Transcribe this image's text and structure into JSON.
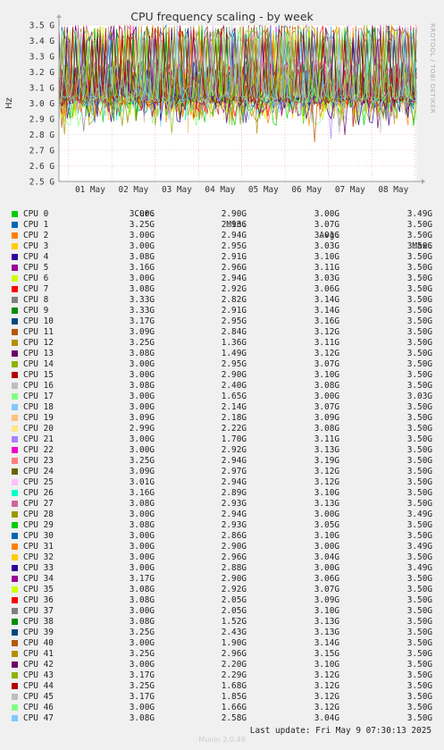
{
  "title": "CPU frequency scaling - by week",
  "side_label": "RRDTOOL / TOBI OETIKER",
  "ylabel": "Hz",
  "columns": [
    "Cur:",
    "Min:",
    "Avg:",
    "Max:"
  ],
  "last_update": "Last update: Fri May  9 07:30:13 2025",
  "footer": "Munin 2.0.49",
  "chart_data": {
    "type": "line",
    "title": "CPU frequency scaling - by week",
    "ylabel": "Hz",
    "ylim": [
      2.5,
      3.5
    ],
    "yticks": [
      "2.5 G",
      "2.6 G",
      "2.7 G",
      "2.8 G",
      "2.9 G",
      "3.0 G",
      "3.1 G",
      "3.2 G",
      "3.3 G",
      "3.4 G",
      "3.5 G"
    ],
    "categories": [
      "01 May",
      "02 May",
      "03 May",
      "04 May",
      "05 May",
      "06 May",
      "07 May",
      "08 May"
    ],
    "grid": true,
    "legend": "below",
    "series": [
      {
        "name": "CPU 0",
        "color": "#00cc00",
        "cur": "3.00G",
        "min": "2.90G",
        "avg": "3.00G",
        "max": "3.49G"
      },
      {
        "name": "CPU 1",
        "color": "#0066b3",
        "cur": "3.25G",
        "min": "2.93G",
        "avg": "3.07G",
        "max": "3.50G"
      },
      {
        "name": "CPU 2",
        "color": "#ff8000",
        "cur": "3.00G",
        "min": "2.94G",
        "avg": "3.01G",
        "max": "3.50G"
      },
      {
        "name": "CPU 3",
        "color": "#ffcc00",
        "cur": "3.00G",
        "min": "2.95G",
        "avg": "3.03G",
        "max": "3.50G"
      },
      {
        "name": "CPU 4",
        "color": "#330099",
        "cur": "3.08G",
        "min": "2.91G",
        "avg": "3.10G",
        "max": "3.50G"
      },
      {
        "name": "CPU 5",
        "color": "#990099",
        "cur": "3.16G",
        "min": "2.96G",
        "avg": "3.11G",
        "max": "3.50G"
      },
      {
        "name": "CPU 6",
        "color": "#ccff00",
        "cur": "3.00G",
        "min": "2.94G",
        "avg": "3.03G",
        "max": "3.50G"
      },
      {
        "name": "CPU 7",
        "color": "#ff0000",
        "cur": "3.08G",
        "min": "2.92G",
        "avg": "3.06G",
        "max": "3.50G"
      },
      {
        "name": "CPU 8",
        "color": "#808080",
        "cur": "3.33G",
        "min": "2.82G",
        "avg": "3.14G",
        "max": "3.50G"
      },
      {
        "name": "CPU 9",
        "color": "#008f00",
        "cur": "3.33G",
        "min": "2.91G",
        "avg": "3.14G",
        "max": "3.50G"
      },
      {
        "name": "CPU 10",
        "color": "#00487d",
        "cur": "3.17G",
        "min": "2.95G",
        "avg": "3.16G",
        "max": "3.50G"
      },
      {
        "name": "CPU 11",
        "color": "#b35a00",
        "cur": "3.09G",
        "min": "2.84G",
        "avg": "3.12G",
        "max": "3.50G"
      },
      {
        "name": "CPU 12",
        "color": "#b38f00",
        "cur": "3.25G",
        "min": "1.36G",
        "avg": "3.11G",
        "max": "3.50G"
      },
      {
        "name": "CPU 13",
        "color": "#6b006b",
        "cur": "3.08G",
        "min": "1.49G",
        "avg": "3.12G",
        "max": "3.50G"
      },
      {
        "name": "CPU 14",
        "color": "#8fb300",
        "cur": "3.00G",
        "min": "2.95G",
        "avg": "3.07G",
        "max": "3.50G"
      },
      {
        "name": "CPU 15",
        "color": "#b30000",
        "cur": "3.00G",
        "min": "2.90G",
        "avg": "3.10G",
        "max": "3.50G"
      },
      {
        "name": "CPU 16",
        "color": "#bebebe",
        "cur": "3.08G",
        "min": "2.40G",
        "avg": "3.08G",
        "max": "3.50G"
      },
      {
        "name": "CPU 17",
        "color": "#80ff80",
        "cur": "3.00G",
        "min": "1.65G",
        "avg": "3.00G",
        "max": "3.03G"
      },
      {
        "name": "CPU 18",
        "color": "#80c9ff",
        "cur": "3.00G",
        "min": "2.14G",
        "avg": "3.07G",
        "max": "3.50G"
      },
      {
        "name": "CPU 19",
        "color": "#ffc080",
        "cur": "3.09G",
        "min": "2.18G",
        "avg": "3.09G",
        "max": "3.50G"
      },
      {
        "name": "CPU 20",
        "color": "#ffe680",
        "cur": "2.99G",
        "min": "2.22G",
        "avg": "3.08G",
        "max": "3.50G"
      },
      {
        "name": "CPU 21",
        "color": "#aa80ff",
        "cur": "3.00G",
        "min": "1.70G",
        "avg": "3.11G",
        "max": "3.50G"
      },
      {
        "name": "CPU 22",
        "color": "#ee00cc",
        "cur": "3.00G",
        "min": "2.92G",
        "avg": "3.13G",
        "max": "3.50G"
      },
      {
        "name": "CPU 23",
        "color": "#ff8080",
        "cur": "3.25G",
        "min": "2.94G",
        "avg": "3.19G",
        "max": "3.50G"
      },
      {
        "name": "CPU 24",
        "color": "#666600",
        "cur": "3.09G",
        "min": "2.97G",
        "avg": "3.12G",
        "max": "3.50G"
      },
      {
        "name": "CPU 25",
        "color": "#ffbfff",
        "cur": "3.01G",
        "min": "2.94G",
        "avg": "3.12G",
        "max": "3.50G"
      },
      {
        "name": "CPU 26",
        "color": "#00ffcc",
        "cur": "3.16G",
        "min": "2.89G",
        "avg": "3.10G",
        "max": "3.50G"
      },
      {
        "name": "CPU 27",
        "color": "#cc6699",
        "cur": "3.08G",
        "min": "2.93G",
        "avg": "3.13G",
        "max": "3.50G"
      },
      {
        "name": "CPU 28",
        "color": "#999900",
        "cur": "3.00G",
        "min": "2.94G",
        "avg": "3.00G",
        "max": "3.49G"
      },
      {
        "name": "CPU 29",
        "color": "#00cc00",
        "cur": "3.08G",
        "min": "2.93G",
        "avg": "3.05G",
        "max": "3.50G"
      },
      {
        "name": "CPU 30",
        "color": "#0066b3",
        "cur": "3.00G",
        "min": "2.86G",
        "avg": "3.10G",
        "max": "3.50G"
      },
      {
        "name": "CPU 31",
        "color": "#ff8000",
        "cur": "3.00G",
        "min": "2.90G",
        "avg": "3.00G",
        "max": "3.49G"
      },
      {
        "name": "CPU 32",
        "color": "#ffcc00",
        "cur": "3.00G",
        "min": "2.96G",
        "avg": "3.04G",
        "max": "3.50G"
      },
      {
        "name": "CPU 33",
        "color": "#330099",
        "cur": "3.00G",
        "min": "2.88G",
        "avg": "3.00G",
        "max": "3.49G"
      },
      {
        "name": "CPU 34",
        "color": "#990099",
        "cur": "3.17G",
        "min": "2.90G",
        "avg": "3.06G",
        "max": "3.50G"
      },
      {
        "name": "CPU 35",
        "color": "#ccff00",
        "cur": "3.08G",
        "min": "2.92G",
        "avg": "3.07G",
        "max": "3.50G"
      },
      {
        "name": "CPU 36",
        "color": "#ff0000",
        "cur": "3.08G",
        "min": "2.05G",
        "avg": "3.09G",
        "max": "3.50G"
      },
      {
        "name": "CPU 37",
        "color": "#808080",
        "cur": "3.00G",
        "min": "2.05G",
        "avg": "3.10G",
        "max": "3.50G"
      },
      {
        "name": "CPU 38",
        "color": "#008f00",
        "cur": "3.08G",
        "min": "1.52G",
        "avg": "3.13G",
        "max": "3.50G"
      },
      {
        "name": "CPU 39",
        "color": "#00487d",
        "cur": "3.25G",
        "min": "2.43G",
        "avg": "3.13G",
        "max": "3.50G"
      },
      {
        "name": "CPU 40",
        "color": "#b35a00",
        "cur": "3.00G",
        "min": "1.90G",
        "avg": "3.14G",
        "max": "3.50G"
      },
      {
        "name": "CPU 41",
        "color": "#b38f00",
        "cur": "3.25G",
        "min": "2.96G",
        "avg": "3.15G",
        "max": "3.50G"
      },
      {
        "name": "CPU 42",
        "color": "#6b006b",
        "cur": "3.00G",
        "min": "2.20G",
        "avg": "3.10G",
        "max": "3.50G"
      },
      {
        "name": "CPU 43",
        "color": "#8fb300",
        "cur": "3.17G",
        "min": "2.29G",
        "avg": "3.12G",
        "max": "3.50G"
      },
      {
        "name": "CPU 44",
        "color": "#b30000",
        "cur": "3.25G",
        "min": "1.68G",
        "avg": "3.12G",
        "max": "3.50G"
      },
      {
        "name": "CPU 45",
        "color": "#bebebe",
        "cur": "3.17G",
        "min": "1.85G",
        "avg": "3.12G",
        "max": "3.50G"
      },
      {
        "name": "CPU 46",
        "color": "#80ff80",
        "cur": "3.00G",
        "min": "1.66G",
        "avg": "3.12G",
        "max": "3.50G"
      },
      {
        "name": "CPU 47",
        "color": "#80c9ff",
        "cur": "3.08G",
        "min": "2.58G",
        "avg": "3.04G",
        "max": "3.50G"
      }
    ]
  }
}
